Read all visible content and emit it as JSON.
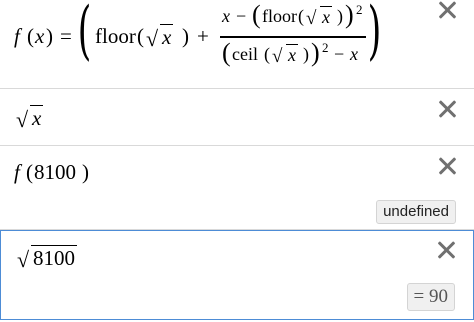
{
  "expressions": [
    {
      "f_name": "f",
      "f_var": "x",
      "equals": "=",
      "floor1": "floor",
      "sqrt_var1": "x",
      "plus": "+",
      "num_x": "x",
      "minus": "−",
      "floor2": "floor",
      "sqrt_var2": "x",
      "exp1": "2",
      "ceil": "ceil",
      "sqrt_var3": "x",
      "exp2": "2",
      "minus2": "−",
      "den_x": "x"
    },
    {
      "sqrt_var": "x"
    },
    {
      "f_name": "f",
      "arg": "8100",
      "result": "undefined"
    },
    {
      "sqrt_arg": "8100",
      "result": "= 90"
    }
  ],
  "icons": {
    "delete": "close-icon"
  }
}
